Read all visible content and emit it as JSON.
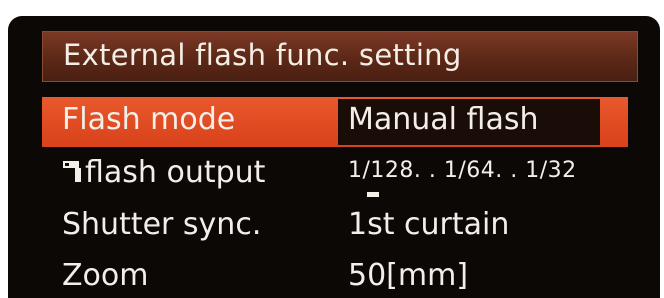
{
  "menu": {
    "title": "External flash func. setting",
    "items": [
      {
        "label": "Flash mode",
        "value": "Manual flash"
      },
      {
        "label": "flash output",
        "value": "1/128.  . 1/64.  . 1/32",
        "icon": "flash-exposure-icon"
      },
      {
        "label": "Shutter sync.",
        "value": "1st curtain"
      },
      {
        "label": "Zoom",
        "value": "50[mm]"
      }
    ]
  },
  "colors": {
    "highlight": "#df4a21",
    "title_bar": "#5c2817",
    "background": "#0b0806",
    "text": "#f2eee8"
  }
}
